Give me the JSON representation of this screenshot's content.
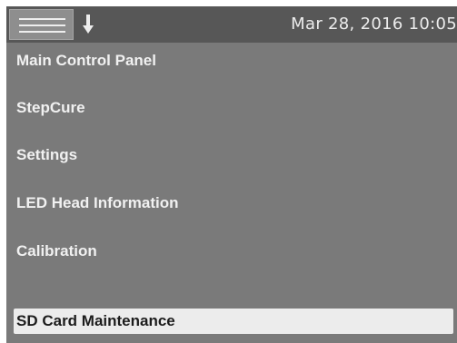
{
  "header": {
    "datetime": "Mar 28, 2016 10:05",
    "menu_icon": "hamburger-menu-icon",
    "action_icon": "arrow-down-icon"
  },
  "menu": {
    "items": [
      {
        "label": "Main Control Panel",
        "selected": false
      },
      {
        "label": "StepCure",
        "selected": false
      },
      {
        "label": "Settings",
        "selected": false
      },
      {
        "label": "LED Head Information",
        "selected": false
      },
      {
        "label": "Calibration",
        "selected": false
      },
      {
        "label": "SD Card Maintenance",
        "selected": true
      }
    ]
  },
  "colors": {
    "background": "#7a7a7a",
    "topbar": "#575757",
    "selected_bg": "#ececec",
    "text": "#f1f1f1"
  }
}
